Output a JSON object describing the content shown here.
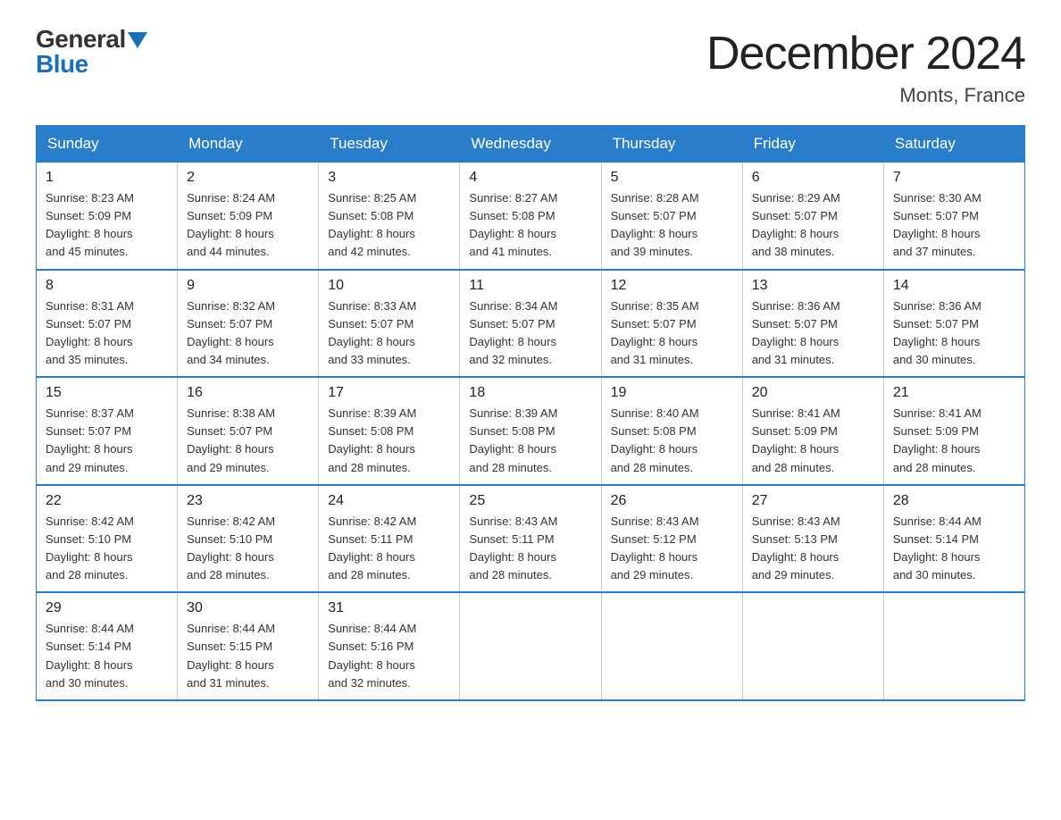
{
  "logo": {
    "general": "General",
    "blue": "Blue",
    "triangle": "▲"
  },
  "title": "December 2024",
  "subtitle": "Monts, France",
  "headers": [
    "Sunday",
    "Monday",
    "Tuesday",
    "Wednesday",
    "Thursday",
    "Friday",
    "Saturday"
  ],
  "weeks": [
    [
      {
        "day": "1",
        "info": "Sunrise: 8:23 AM\nSunset: 5:09 PM\nDaylight: 8 hours\nand 45 minutes."
      },
      {
        "day": "2",
        "info": "Sunrise: 8:24 AM\nSunset: 5:09 PM\nDaylight: 8 hours\nand 44 minutes."
      },
      {
        "day": "3",
        "info": "Sunrise: 8:25 AM\nSunset: 5:08 PM\nDaylight: 8 hours\nand 42 minutes."
      },
      {
        "day": "4",
        "info": "Sunrise: 8:27 AM\nSunset: 5:08 PM\nDaylight: 8 hours\nand 41 minutes."
      },
      {
        "day": "5",
        "info": "Sunrise: 8:28 AM\nSunset: 5:07 PM\nDaylight: 8 hours\nand 39 minutes."
      },
      {
        "day": "6",
        "info": "Sunrise: 8:29 AM\nSunset: 5:07 PM\nDaylight: 8 hours\nand 38 minutes."
      },
      {
        "day": "7",
        "info": "Sunrise: 8:30 AM\nSunset: 5:07 PM\nDaylight: 8 hours\nand 37 minutes."
      }
    ],
    [
      {
        "day": "8",
        "info": "Sunrise: 8:31 AM\nSunset: 5:07 PM\nDaylight: 8 hours\nand 35 minutes."
      },
      {
        "day": "9",
        "info": "Sunrise: 8:32 AM\nSunset: 5:07 PM\nDaylight: 8 hours\nand 34 minutes."
      },
      {
        "day": "10",
        "info": "Sunrise: 8:33 AM\nSunset: 5:07 PM\nDaylight: 8 hours\nand 33 minutes."
      },
      {
        "day": "11",
        "info": "Sunrise: 8:34 AM\nSunset: 5:07 PM\nDaylight: 8 hours\nand 32 minutes."
      },
      {
        "day": "12",
        "info": "Sunrise: 8:35 AM\nSunset: 5:07 PM\nDaylight: 8 hours\nand 31 minutes."
      },
      {
        "day": "13",
        "info": "Sunrise: 8:36 AM\nSunset: 5:07 PM\nDaylight: 8 hours\nand 31 minutes."
      },
      {
        "day": "14",
        "info": "Sunrise: 8:36 AM\nSunset: 5:07 PM\nDaylight: 8 hours\nand 30 minutes."
      }
    ],
    [
      {
        "day": "15",
        "info": "Sunrise: 8:37 AM\nSunset: 5:07 PM\nDaylight: 8 hours\nand 29 minutes."
      },
      {
        "day": "16",
        "info": "Sunrise: 8:38 AM\nSunset: 5:07 PM\nDaylight: 8 hours\nand 29 minutes."
      },
      {
        "day": "17",
        "info": "Sunrise: 8:39 AM\nSunset: 5:08 PM\nDaylight: 8 hours\nand 28 minutes."
      },
      {
        "day": "18",
        "info": "Sunrise: 8:39 AM\nSunset: 5:08 PM\nDaylight: 8 hours\nand 28 minutes."
      },
      {
        "day": "19",
        "info": "Sunrise: 8:40 AM\nSunset: 5:08 PM\nDaylight: 8 hours\nand 28 minutes."
      },
      {
        "day": "20",
        "info": "Sunrise: 8:41 AM\nSunset: 5:09 PM\nDaylight: 8 hours\nand 28 minutes."
      },
      {
        "day": "21",
        "info": "Sunrise: 8:41 AM\nSunset: 5:09 PM\nDaylight: 8 hours\nand 28 minutes."
      }
    ],
    [
      {
        "day": "22",
        "info": "Sunrise: 8:42 AM\nSunset: 5:10 PM\nDaylight: 8 hours\nand 28 minutes."
      },
      {
        "day": "23",
        "info": "Sunrise: 8:42 AM\nSunset: 5:10 PM\nDaylight: 8 hours\nand 28 minutes."
      },
      {
        "day": "24",
        "info": "Sunrise: 8:42 AM\nSunset: 5:11 PM\nDaylight: 8 hours\nand 28 minutes."
      },
      {
        "day": "25",
        "info": "Sunrise: 8:43 AM\nSunset: 5:11 PM\nDaylight: 8 hours\nand 28 minutes."
      },
      {
        "day": "26",
        "info": "Sunrise: 8:43 AM\nSunset: 5:12 PM\nDaylight: 8 hours\nand 29 minutes."
      },
      {
        "day": "27",
        "info": "Sunrise: 8:43 AM\nSunset: 5:13 PM\nDaylight: 8 hours\nand 29 minutes."
      },
      {
        "day": "28",
        "info": "Sunrise: 8:44 AM\nSunset: 5:14 PM\nDaylight: 8 hours\nand 30 minutes."
      }
    ],
    [
      {
        "day": "29",
        "info": "Sunrise: 8:44 AM\nSunset: 5:14 PM\nDaylight: 8 hours\nand 30 minutes."
      },
      {
        "day": "30",
        "info": "Sunrise: 8:44 AM\nSunset: 5:15 PM\nDaylight: 8 hours\nand 31 minutes."
      },
      {
        "day": "31",
        "info": "Sunrise: 8:44 AM\nSunset: 5:16 PM\nDaylight: 8 hours\nand 32 minutes."
      },
      {
        "day": "",
        "info": ""
      },
      {
        "day": "",
        "info": ""
      },
      {
        "day": "",
        "info": ""
      },
      {
        "day": "",
        "info": ""
      }
    ]
  ]
}
